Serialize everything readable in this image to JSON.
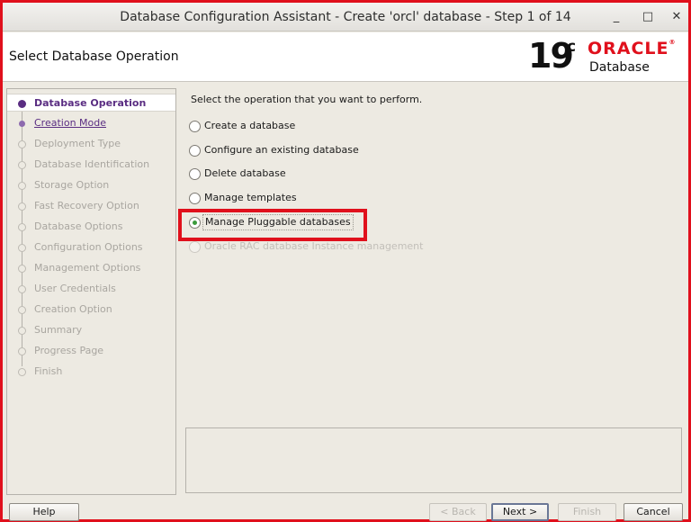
{
  "window": {
    "title": "Database Configuration Assistant - Create 'orcl' database - Step 1 of 14",
    "controls": {
      "minimize": "_",
      "maximize": "□",
      "close": "✕"
    }
  },
  "header": {
    "page_title": "Select Database Operation",
    "logo": {
      "version": "19",
      "version_sup": "c",
      "brand": "ORACLE",
      "brand_mark": "®",
      "product": "Database"
    }
  },
  "steps": [
    {
      "label": "Database Operation",
      "state": "current"
    },
    {
      "label": "Creation Mode",
      "state": "link"
    },
    {
      "label": "Deployment Type",
      "state": "disabled"
    },
    {
      "label": "Database Identification",
      "state": "disabled"
    },
    {
      "label": "Storage Option",
      "state": "disabled"
    },
    {
      "label": "Fast Recovery Option",
      "state": "disabled"
    },
    {
      "label": "Database Options",
      "state": "disabled"
    },
    {
      "label": "Configuration Options",
      "state": "disabled"
    },
    {
      "label": "Management Options",
      "state": "disabled"
    },
    {
      "label": "User Credentials",
      "state": "disabled"
    },
    {
      "label": "Creation Option",
      "state": "disabled"
    },
    {
      "label": "Summary",
      "state": "disabled"
    },
    {
      "label": "Progress Page",
      "state": "disabled"
    },
    {
      "label": "Finish",
      "state": "disabled"
    }
  ],
  "content": {
    "prompt": "Select the operation that you want to perform.",
    "options": [
      {
        "label": "Create a database",
        "checked": false,
        "enabled": true
      },
      {
        "label": "Configure an existing database",
        "checked": false,
        "enabled": true
      },
      {
        "label": "Delete database",
        "checked": false,
        "enabled": true
      },
      {
        "label": "Manage templates",
        "checked": false,
        "enabled": true
      },
      {
        "label": "Manage Pluggable databases",
        "checked": true,
        "enabled": true
      },
      {
        "label": "Oracle RAC database Instance management",
        "checked": false,
        "enabled": false
      }
    ]
  },
  "buttons": {
    "help": "Help",
    "back": "< Back",
    "next": "Next >",
    "finish": "Finish",
    "cancel": "Cancel"
  },
  "colors": {
    "highlight": "#e0101c",
    "step_current": "#5a2d82",
    "oracle_red": "#e0101c",
    "radio_checked": "#3b9b3b"
  }
}
